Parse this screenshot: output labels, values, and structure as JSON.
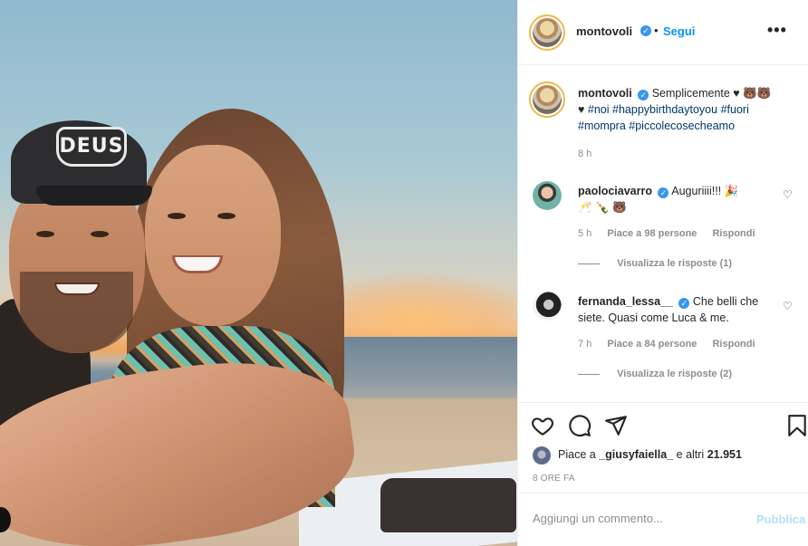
{
  "post": {
    "author": "montovoli",
    "follow_label": "Segui",
    "more_label": "•••",
    "dot": "•"
  },
  "caption": {
    "username": "montovoli",
    "text_1": "Semplicemente ♥ 🐻🐻",
    "text_2": "♥",
    "hashtags": [
      "#noi",
      "#happybirthdaytoyou",
      "#fuori",
      "#mompra",
      "#piccolecosecheamo"
    ],
    "time": "8 h"
  },
  "comments": [
    {
      "username": "paolociavarro",
      "text_1": "Auguriiii!!! 🎉",
      "text_2": "🥂 🍾 🐻",
      "time": "5 h",
      "likes": "Piace a 98 persone",
      "reply_label": "Rispondi",
      "view_replies": "Visualizza le risposte (1)"
    },
    {
      "username": "fernanda_lessa__",
      "text_1": "Che belli che",
      "text_2": "siete. Quasi come Luca & me.",
      "time": "7 h",
      "likes": "Piace a 84 persone",
      "reply_label": "Rispondi",
      "view_replies": "Visualizza le risposte (2)"
    }
  ],
  "likes_summary": {
    "prefix": "Piace a ",
    "user": "_giusyfaiella_",
    "middle": " e altri ",
    "count": "21.951"
  },
  "post_time": "8 ORE FA",
  "comment_box": {
    "placeholder": "Aggiungi un commento...",
    "publish_label": "Pubblica"
  },
  "photo": {
    "cap_text": "DEUS"
  },
  "icons": {
    "verified": "verified-badge-icon",
    "like": "heart-icon",
    "comment": "comment-bubble-icon",
    "share": "paper-plane-icon",
    "save": "bookmark-icon"
  },
  "colors": {
    "link": "#0095f6",
    "hashtag": "#00376b",
    "verified": "#3897f0",
    "muted": "#8e8e8e",
    "publish_disabled": "#b2dffc"
  }
}
